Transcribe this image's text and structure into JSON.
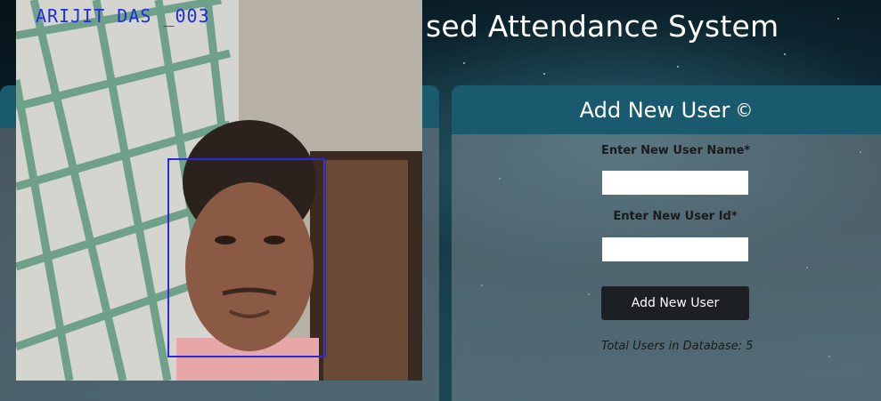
{
  "app": {
    "title": "sed Attendance System"
  },
  "camera": {
    "detected_label": "ARIJIT DAS _003"
  },
  "add_user_panel": {
    "heading": "Add New User",
    "heading_symbol": "©",
    "name_label": "Enter New User Name*",
    "name_value": "",
    "id_label": "Enter New User Id*",
    "id_value": "",
    "submit_label": "Add New User",
    "total_users_text": "Total Users in Database: 5"
  },
  "colors": {
    "panel_header": "#1a5a6e",
    "button": "#1c1f23",
    "face_box": "#2a2ad8"
  }
}
